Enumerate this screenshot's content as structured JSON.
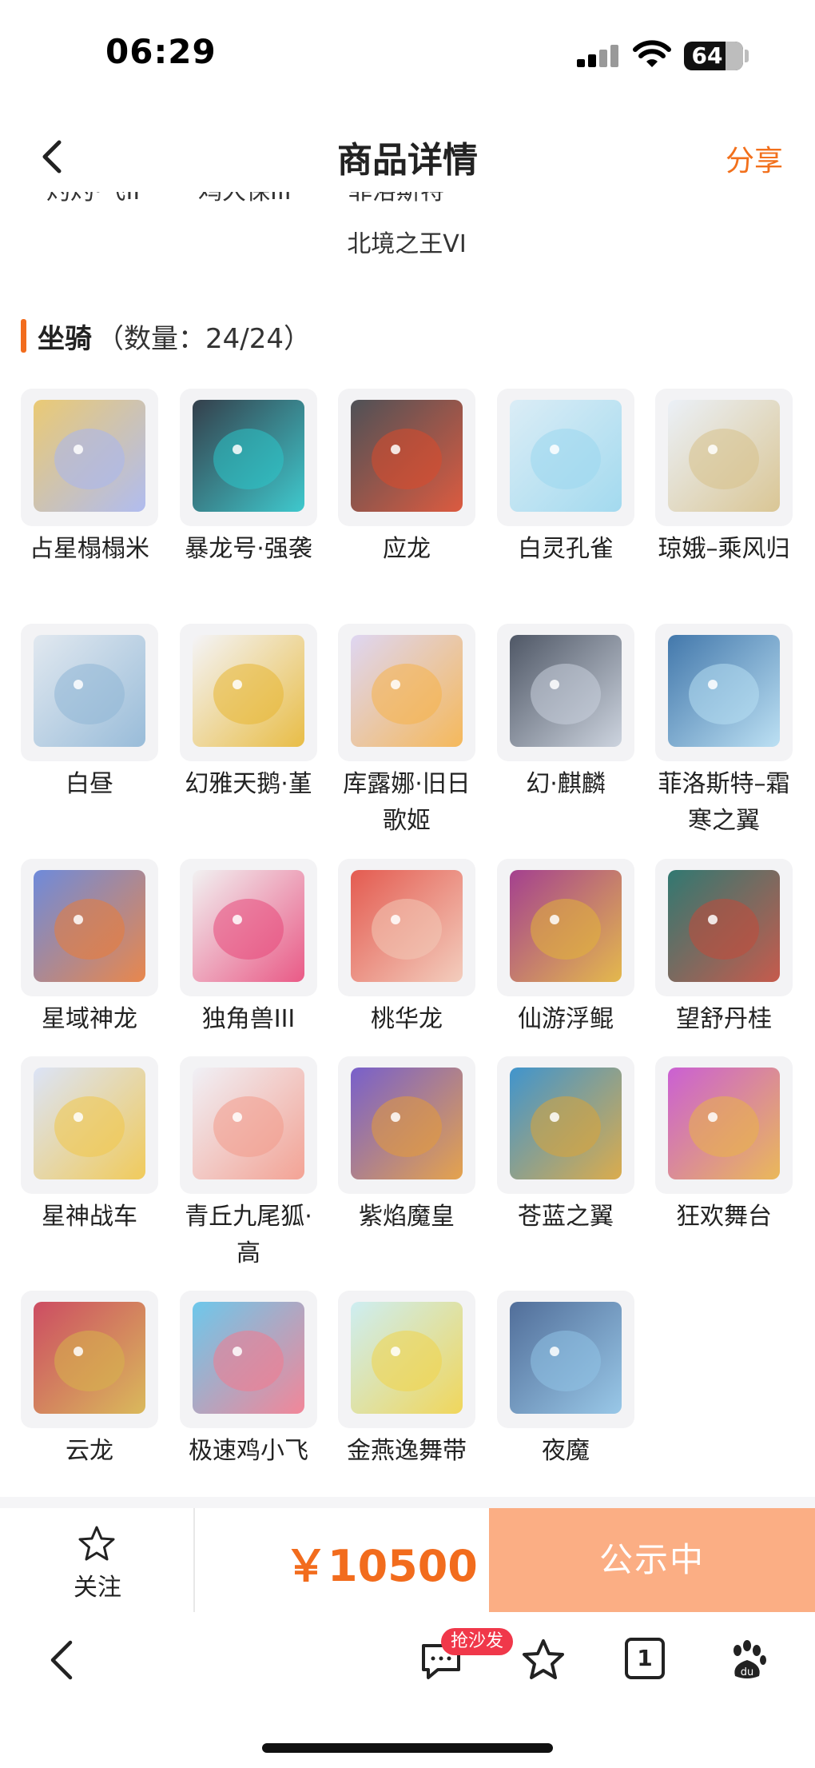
{
  "status_bar": {
    "time": "06:29",
    "battery": "64"
  },
  "header": {
    "title": "商品详情",
    "share_label": "分享"
  },
  "previous_section": {
    "cut_labels": [
      "灼灼·飞II",
      "鸡大保III",
      "菲洛斯特"
    ],
    "last_item_name": "北境之王VI"
  },
  "section": {
    "title": "坐骑",
    "count_text": "（数量：24/24）"
  },
  "mounts": [
    {
      "name": "占星榻榻米",
      "icon": "star-tatami-icon"
    },
    {
      "name": "暴龙号·强袭",
      "icon": "mech-dragon-icon"
    },
    {
      "name": "应龙",
      "icon": "dragon-icon"
    },
    {
      "name": "白灵孔雀",
      "icon": "peacock-icon"
    },
    {
      "name": "琼娥–乘风归",
      "icon": "fairy-icon"
    },
    {
      "name": "白昼",
      "icon": "white-beast-icon"
    },
    {
      "name": "幻雅天鹅·堇",
      "icon": "swan-icon"
    },
    {
      "name": "库露娜·旧日歌姬",
      "icon": "singer-icon"
    },
    {
      "name": "幻·麒麟",
      "icon": "qilin-icon"
    },
    {
      "name": "菲洛斯特–霜寒之翼",
      "icon": "frost-wing-icon"
    },
    {
      "name": "星域神龙",
      "icon": "star-dragon-icon"
    },
    {
      "name": "独角兽III",
      "icon": "unicorn-icon"
    },
    {
      "name": "桃华龙",
      "icon": "peach-dragon-icon"
    },
    {
      "name": "仙游浮鲲",
      "icon": "whale-icon"
    },
    {
      "name": "望舒丹桂",
      "icon": "swing-icon"
    },
    {
      "name": "星神战车",
      "icon": "chariot-icon"
    },
    {
      "name": "青丘九尾狐·高",
      "icon": "nine-tail-fox-icon"
    },
    {
      "name": "紫焰魔皇",
      "icon": "purple-phoenix-icon"
    },
    {
      "name": "苍蓝之翼",
      "icon": "blue-eagle-icon"
    },
    {
      "name": "狂欢舞台",
      "icon": "heart-stage-icon"
    },
    {
      "name": "云龙",
      "icon": "cloud-dragon-icon"
    },
    {
      "name": "极速鸡小飞",
      "icon": "chick-icon"
    },
    {
      "name": "金燕逸舞带",
      "icon": "ribbon-icon"
    },
    {
      "name": "夜魔",
      "icon": "night-horse-icon"
    }
  ],
  "colors": {
    "accent": "#f26c1d",
    "status_button_bg": "#fbae84",
    "badge": "#f0384a"
  },
  "action_bar": {
    "follow_label": "关注",
    "price": "￥10500",
    "status_label": "公示中"
  },
  "browser_bar": {
    "badge": "抢沙发",
    "tab_count": "1"
  }
}
